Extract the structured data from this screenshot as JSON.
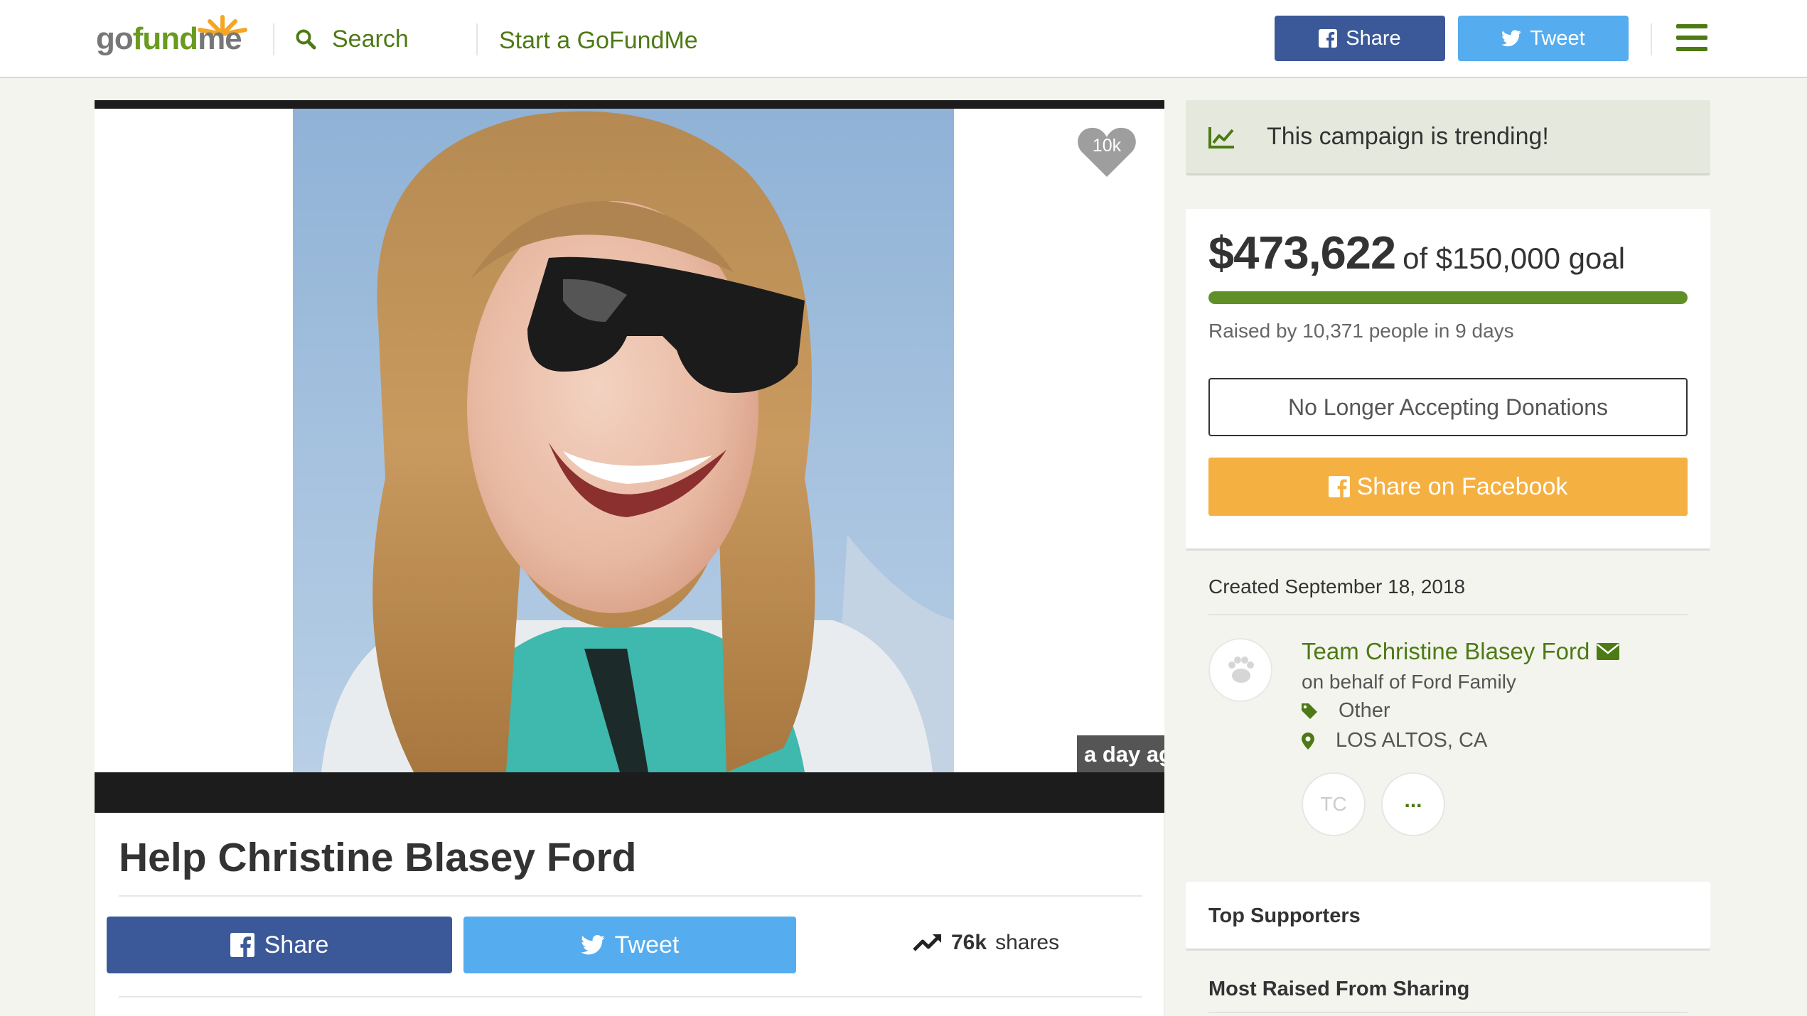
{
  "header": {
    "logo_text": "gofundme",
    "search_label": "Search",
    "start_label": "Start a GoFundMe",
    "share_label": "Share",
    "tweet_label": "Tweet"
  },
  "media": {
    "heart_count": "10k",
    "timestamp_overlay": "a day ago"
  },
  "campaign": {
    "title": "Help Christine Blasey Ford",
    "share_label": "Share",
    "tweet_label": "Tweet",
    "shares_count": "76k",
    "shares_word": "shares"
  },
  "trending": {
    "text": "This campaign is trending!"
  },
  "funding": {
    "raised_amount": "$473,622",
    "goal_text": "of $150,000 goal",
    "progress_fraction": 1.0,
    "raised_by_text": "Raised by 10,371 people in 9 days",
    "status_button": "No Longer Accepting Donations",
    "share_facebook_label": "Share on Facebook"
  },
  "organizer": {
    "created_text": "Created September 18, 2018",
    "name": "Team Christine Blasey Ford",
    "on_behalf": "on behalf of Ford Family",
    "category": "Other",
    "location": "LOS ALTOS, CA",
    "team_initials": "TC",
    "more_label": "..."
  },
  "sections": {
    "top_supporters": "Top Supporters",
    "most_raised_sharing": "Most Raised From Sharing"
  },
  "colors": {
    "brand_green": "#4d7a14",
    "facebook_blue": "#3b5998",
    "twitter_blue": "#55acee",
    "share_orange": "#f5b042",
    "progress_green": "#5f8f26"
  }
}
